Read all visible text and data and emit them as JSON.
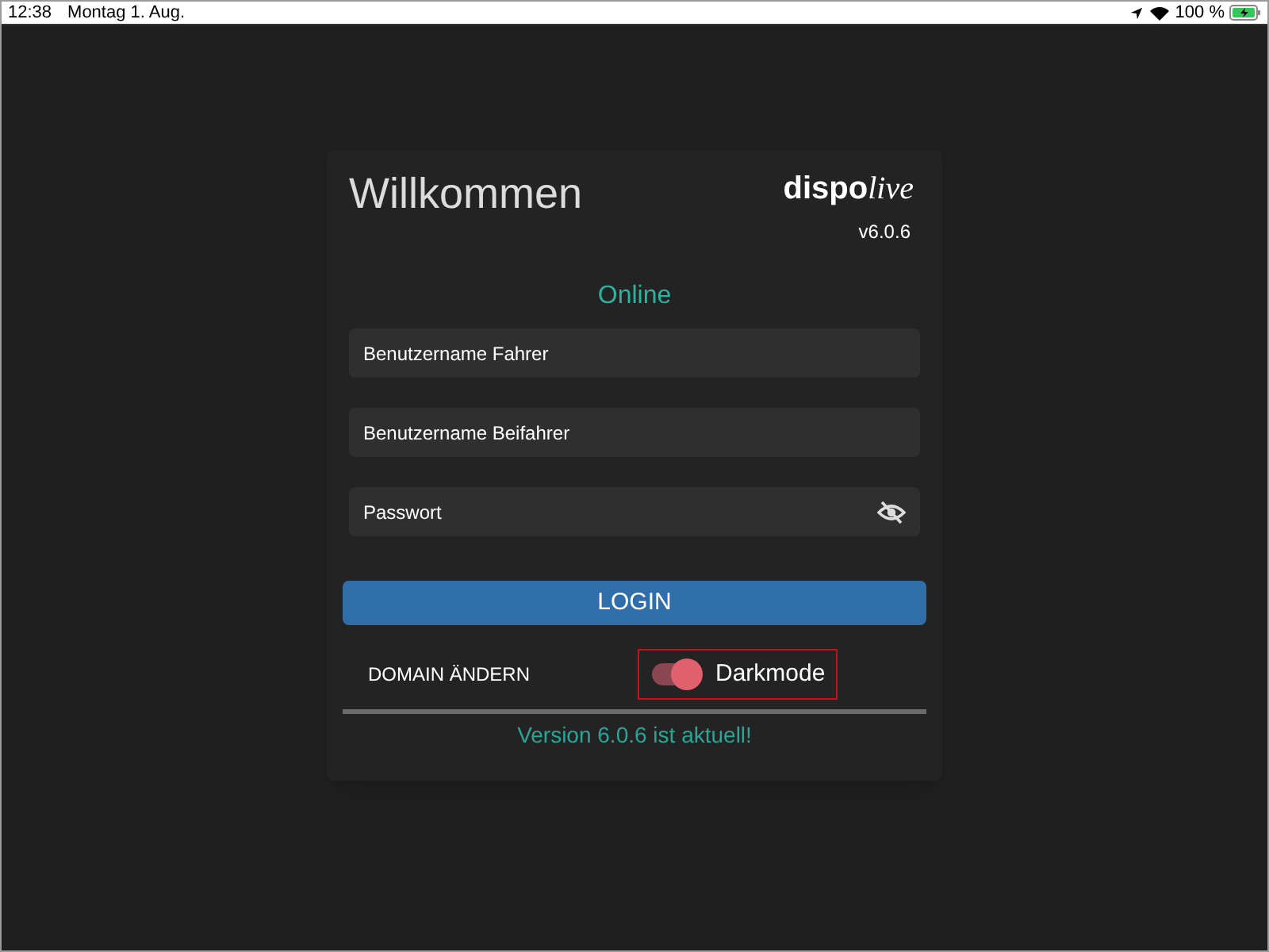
{
  "status_bar": {
    "time": "12:38",
    "date": "Montag 1. Aug.",
    "battery": "100 %"
  },
  "card": {
    "title": "Willkommen",
    "logo": {
      "part_1": "dispo",
      "part_2": "live"
    },
    "version": "v6.0.6",
    "connection": "Online",
    "fields": [
      {
        "placeholder": "Benutzername Fahrer",
        "kind": "text"
      },
      {
        "placeholder": "Benutzername Beifahrer",
        "kind": "text"
      },
      {
        "placeholder": "Passwort",
        "kind": "password"
      }
    ],
    "login_button": "LOGIN",
    "domain_button": "DOMAIN ÄNDERN",
    "darkmode": {
      "label": "Darkmode",
      "on": true,
      "highlighted": true
    },
    "progress": {
      "level": 1
    },
    "update_message": "Version 6.0.6 ist aktuell!"
  }
}
